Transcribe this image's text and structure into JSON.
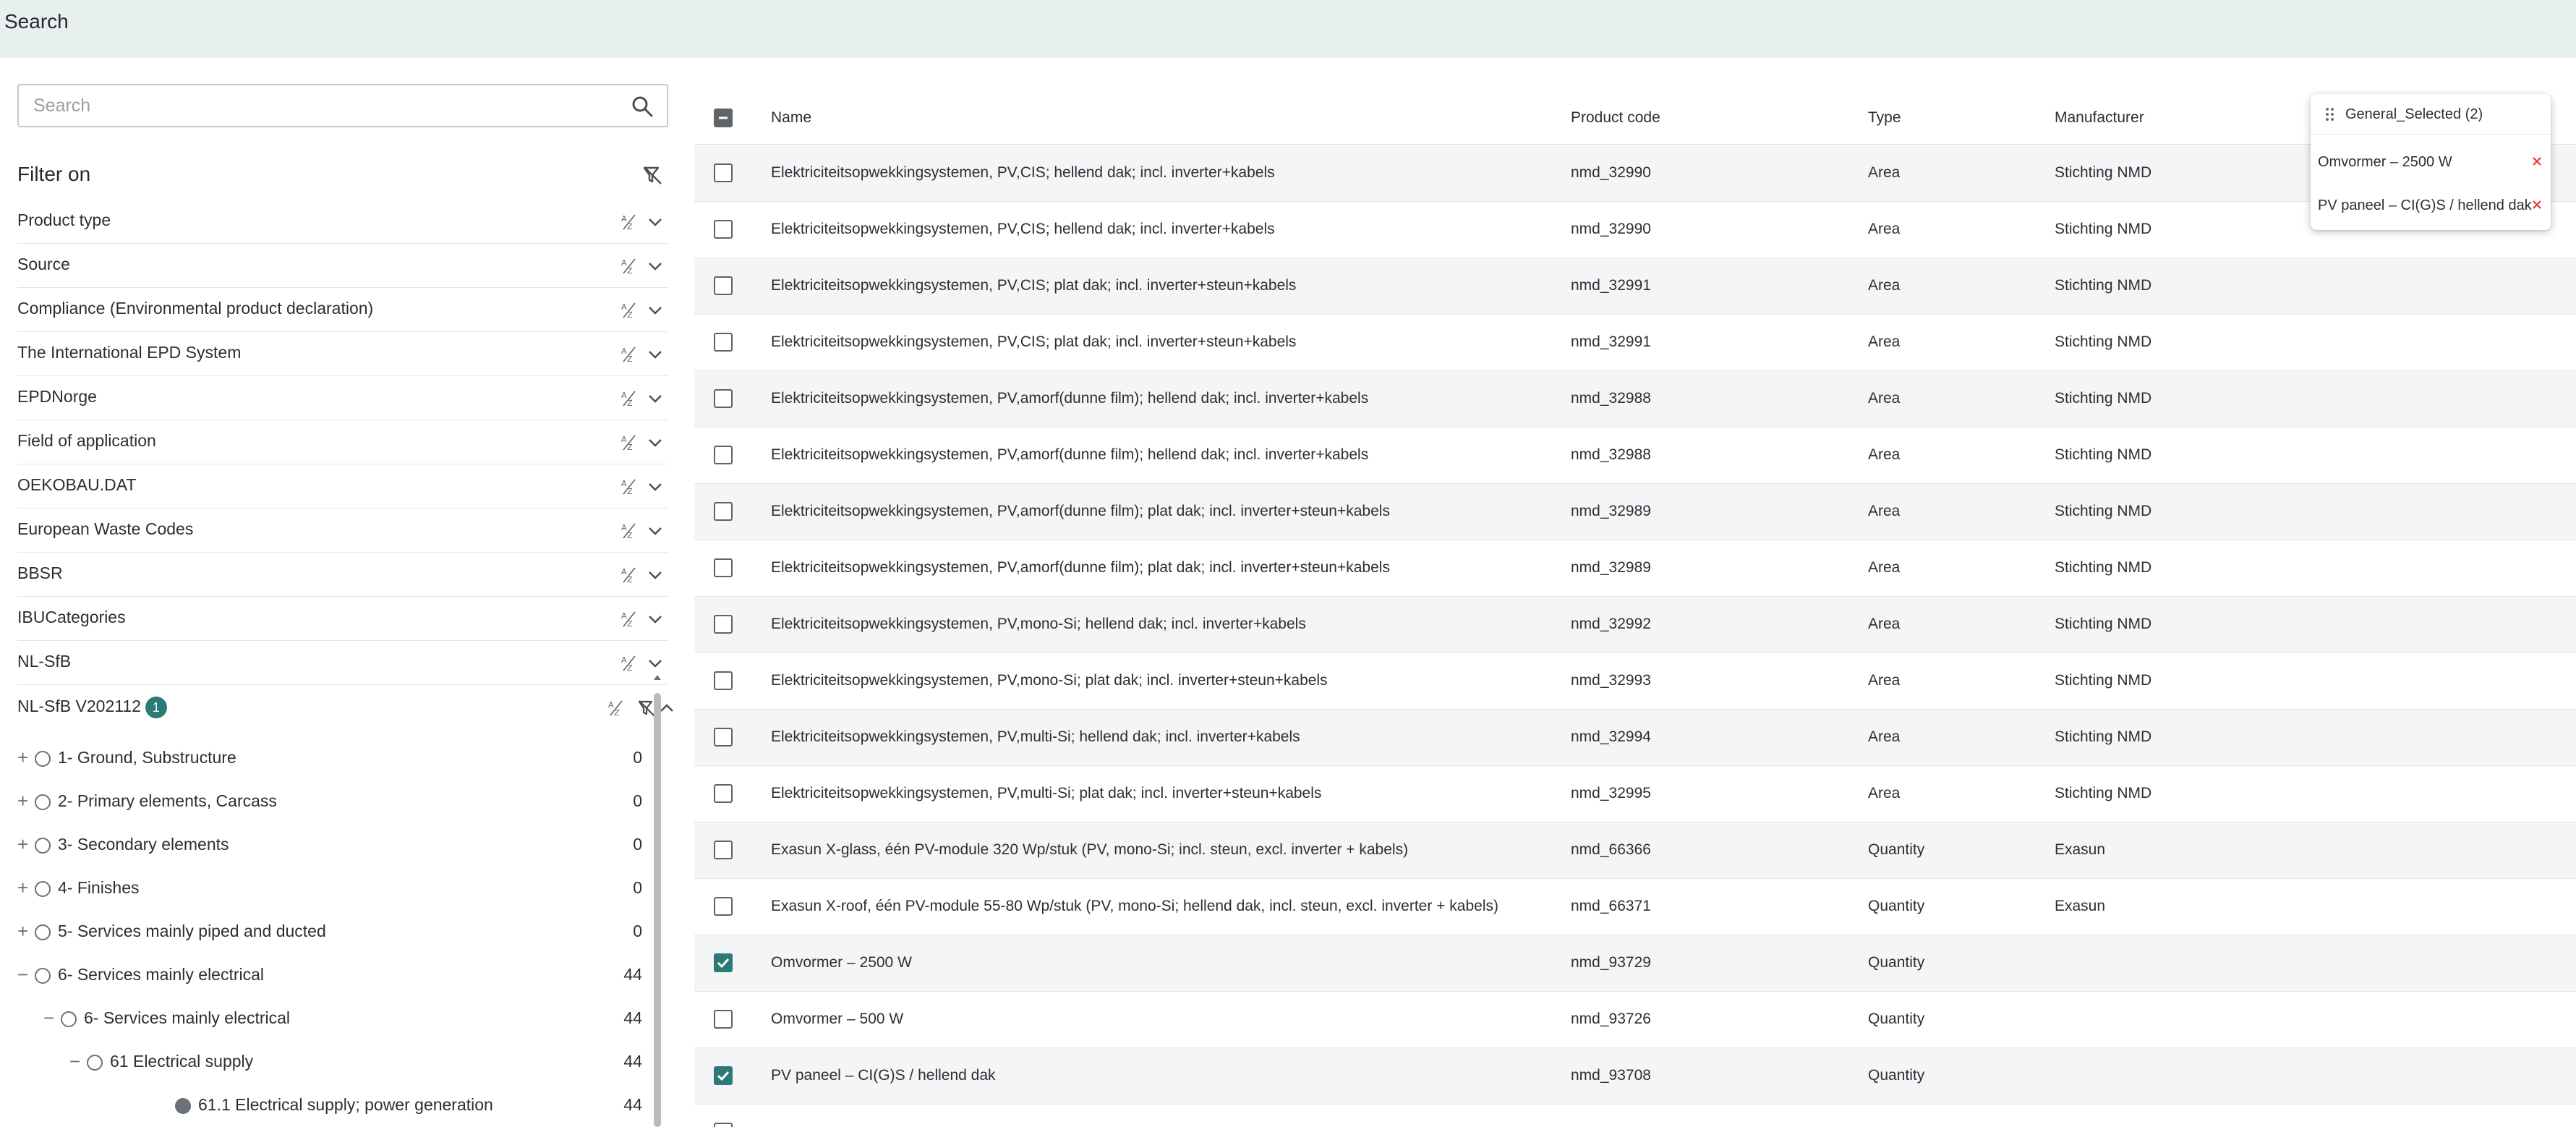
{
  "topbar": {
    "title": "Search"
  },
  "search": {
    "placeholder": "Search",
    "value": ""
  },
  "filter": {
    "title": "Filter on",
    "facets": [
      {
        "label": "Product type"
      },
      {
        "label": "Source"
      },
      {
        "label": "Compliance (Environmental product declaration)"
      },
      {
        "label": "The International EPD System"
      },
      {
        "label": "EPDNorge"
      },
      {
        "label": "Field of application"
      },
      {
        "label": "OEKOBAU.DAT"
      },
      {
        "label": "European Waste Codes"
      },
      {
        "label": "BBSR"
      },
      {
        "label": "IBUCategories"
      },
      {
        "label": "NL-SfB"
      }
    ],
    "expanded_facet": {
      "label": "NL-SfB V202112",
      "badge": "1"
    },
    "tree": [
      {
        "toggle": "+",
        "label": "1- Ground, Substructure",
        "count": "0"
      },
      {
        "toggle": "+",
        "label": "2- Primary elements, Carcass",
        "count": "0"
      },
      {
        "toggle": "+",
        "label": "3- Secondary elements",
        "count": "0"
      },
      {
        "toggle": "+",
        "label": "4- Finishes",
        "count": "0"
      },
      {
        "toggle": "+",
        "label": "5- Services mainly piped and ducted",
        "count": "0"
      },
      {
        "toggle": "−",
        "label": "6- Services mainly electrical",
        "count": "44"
      },
      {
        "toggle": "−",
        "label": "6- Services mainly electrical",
        "count": "44"
      },
      {
        "toggle": "−",
        "label": "61 Electrical supply",
        "count": "44"
      },
      {
        "toggle": "",
        "label": "61.1 Electrical supply; power generation",
        "count": "44"
      }
    ]
  },
  "table": {
    "headers": {
      "name": "Name",
      "code": "Product code",
      "type": "Type",
      "manufacturer": "Manufacturer"
    },
    "rows": [
      {
        "name": "Elektriciteitsopwekkingsystemen, PV,CIS; hellend dak; incl. inverter+kabels",
        "code": "nmd_32990",
        "type": "Area",
        "manufacturer": "Stichting NMD",
        "checked": false
      },
      {
        "name": "Elektriciteitsopwekkingsystemen, PV,CIS; hellend dak; incl. inverter+kabels",
        "code": "nmd_32990",
        "type": "Area",
        "manufacturer": "Stichting NMD",
        "checked": false
      },
      {
        "name": "Elektriciteitsopwekkingsystemen, PV,CIS; plat dak; incl. inverter+steun+kabels",
        "code": "nmd_32991",
        "type": "Area",
        "manufacturer": "Stichting NMD",
        "checked": false
      },
      {
        "name": "Elektriciteitsopwekkingsystemen, PV,CIS; plat dak; incl. inverter+steun+kabels",
        "code": "nmd_32991",
        "type": "Area",
        "manufacturer": "Stichting NMD",
        "checked": false
      },
      {
        "name": "Elektriciteitsopwekkingsystemen, PV,amorf(dunne film); hellend dak; incl. inverter+kabels",
        "code": "nmd_32988",
        "type": "Area",
        "manufacturer": "Stichting NMD",
        "checked": false
      },
      {
        "name": "Elektriciteitsopwekkingsystemen, PV,amorf(dunne film); hellend dak; incl. inverter+kabels",
        "code": "nmd_32988",
        "type": "Area",
        "manufacturer": "Stichting NMD",
        "checked": false
      },
      {
        "name": "Elektriciteitsopwekkingsystemen, PV,amorf(dunne film); plat dak; incl. inverter+steun+kabels",
        "code": "nmd_32989",
        "type": "Area",
        "manufacturer": "Stichting NMD",
        "checked": false
      },
      {
        "name": "Elektriciteitsopwekkingsystemen, PV,amorf(dunne film); plat dak; incl. inverter+steun+kabels",
        "code": "nmd_32989",
        "type": "Area",
        "manufacturer": "Stichting NMD",
        "checked": false
      },
      {
        "name": "Elektriciteitsopwekkingsystemen, PV,mono-Si; hellend dak; incl. inverter+kabels",
        "code": "nmd_32992",
        "type": "Area",
        "manufacturer": "Stichting NMD",
        "checked": false
      },
      {
        "name": "Elektriciteitsopwekkingsystemen, PV,mono-Si; plat dak; incl. inverter+steun+kabels",
        "code": "nmd_32993",
        "type": "Area",
        "manufacturer": "Stichting NMD",
        "checked": false
      },
      {
        "name": "Elektriciteitsopwekkingsystemen, PV,multi-Si; hellend dak; incl. inverter+kabels",
        "code": "nmd_32994",
        "type": "Area",
        "manufacturer": "Stichting NMD",
        "checked": false
      },
      {
        "name": "Elektriciteitsopwekkingsystemen, PV,multi-Si; plat dak; incl. inverter+steun+kabels",
        "code": "nmd_32995",
        "type": "Area",
        "manufacturer": "Stichting NMD",
        "checked": false
      },
      {
        "name": "Exasun X-glass, één PV-module 320 Wp/stuk (PV, mono-Si; incl. steun, excl. inverter + kabels)",
        "code": "nmd_66366",
        "type": "Quantity",
        "manufacturer": "Exasun",
        "checked": false
      },
      {
        "name": "Exasun X-roof, één PV-module 55-80 Wp/stuk (PV, mono-Si; hellend dak, incl. steun, excl. inverter + kabels)",
        "code": "nmd_66371",
        "type": "Quantity",
        "manufacturer": "Exasun",
        "checked": false
      },
      {
        "name": "Omvormer – 2500 W",
        "code": "nmd_93729",
        "type": "Quantity",
        "manufacturer": "",
        "checked": true
      },
      {
        "name": "Omvormer – 500 W",
        "code": "nmd_93726",
        "type": "Quantity",
        "manufacturer": "",
        "checked": false
      },
      {
        "name": "PV paneel – CI(G)S / hellend dak",
        "code": "nmd_93708",
        "type": "Quantity",
        "manufacturer": "",
        "checked": true
      },
      {
        "name": "",
        "code": "",
        "type": "",
        "manufacturer": "",
        "checked": false
      }
    ]
  },
  "popover": {
    "title": "General_Selected (2)",
    "items": [
      {
        "label": "Omvormer – 2500 W"
      },
      {
        "label": "PV paneel – CI(G)S / hellend dak"
      }
    ]
  },
  "colors": {
    "accent": "#2b7a78",
    "topbar": "#e7f0ef",
    "remove": "#e53935"
  }
}
